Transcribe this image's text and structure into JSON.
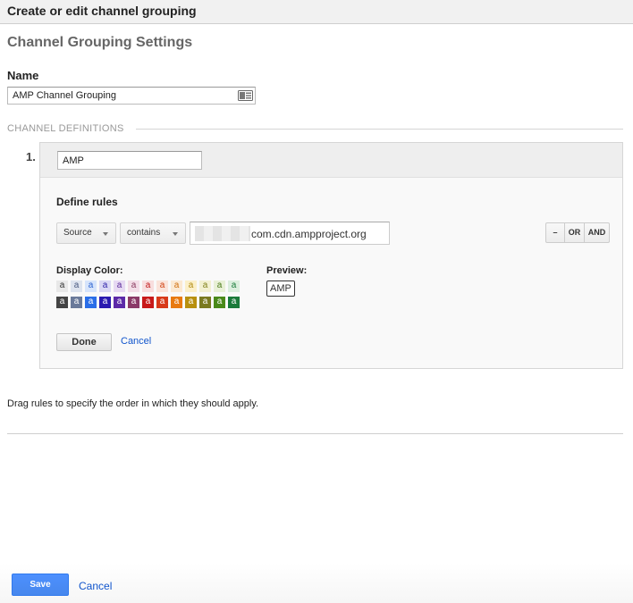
{
  "dialog": {
    "title": "Create or edit channel grouping"
  },
  "settings": {
    "heading": "Channel Grouping Settings"
  },
  "name": {
    "label": "Name",
    "value": "AMP Channel Grouping"
  },
  "channel_definitions": {
    "label": "CHANNEL DEFINITIONS",
    "channels": [
      {
        "index": "1.",
        "name": "AMP",
        "define_rules_label": "Define rules",
        "rule": {
          "dimension": "Source",
          "match_type": "contains",
          "value": "com.cdn.ampproject.org",
          "operators": {
            "remove": "–",
            "or": "OR",
            "and": "AND"
          }
        },
        "display_color_label": "Display Color:",
        "swatch_glyph": "a",
        "light_swatches": [
          {
            "bg": "#e8e8e8",
            "fg": "#333333"
          },
          {
            "bg": "#dde3ee",
            "fg": "#4a5a80"
          },
          {
            "bg": "#d6e4fb",
            "fg": "#2a62d0"
          },
          {
            "bg": "#d9d7f4",
            "fg": "#2c1fa8"
          },
          {
            "bg": "#e6d9f2",
            "fg": "#5a2a9a"
          },
          {
            "bg": "#f2dde7",
            "fg": "#8a3a60"
          },
          {
            "bg": "#f8dede",
            "fg": "#c01a1a"
          },
          {
            "bg": "#fae3da",
            "fg": "#d04010"
          },
          {
            "bg": "#fbe9d2",
            "fg": "#d07010"
          },
          {
            "bg": "#fbefc8",
            "fg": "#b08a10"
          },
          {
            "bg": "#f2f0d0",
            "fg": "#80801a"
          },
          {
            "bg": "#e8f0d6",
            "fg": "#4a7a1a"
          },
          {
            "bg": "#dbeedd",
            "fg": "#1a7a3a"
          }
        ],
        "dark_swatches": [
          {
            "bg": "#444444",
            "fg": "#ffffff"
          },
          {
            "bg": "#6a7a9a",
            "fg": "#ffffff"
          },
          {
            "bg": "#2a6ee8",
            "fg": "#ffffff"
          },
          {
            "bg": "#2a1ab0",
            "fg": "#ffffff"
          },
          {
            "bg": "#5c2aa8",
            "fg": "#ffffff"
          },
          {
            "bg": "#8a3a68",
            "fg": "#ffffff"
          },
          {
            "bg": "#c81a1a",
            "fg": "#ffffff"
          },
          {
            "bg": "#d83a1a",
            "fg": "#ffffff"
          },
          {
            "bg": "#e87a10",
            "fg": "#ffffff"
          },
          {
            "bg": "#b8900e",
            "fg": "#ffffff"
          },
          {
            "bg": "#7a7a20",
            "fg": "#ffffff"
          },
          {
            "bg": "#4a8a1a",
            "fg": "#ffffff"
          },
          {
            "bg": "#1a7a3a",
            "fg": "#ffffff"
          }
        ],
        "preview_label": "Preview:",
        "preview_text": "AMP",
        "done_label": "Done",
        "cancel_label": "Cancel"
      }
    ]
  },
  "drag_hint": "Drag rules to specify the order in which they should apply.",
  "footer": {
    "save_label": "Save",
    "cancel_label": "Cancel"
  },
  "colors": {
    "accent": "#4d90fe",
    "link": "#1155cc"
  },
  "icons": {
    "name_field": "contact-card-icon"
  }
}
